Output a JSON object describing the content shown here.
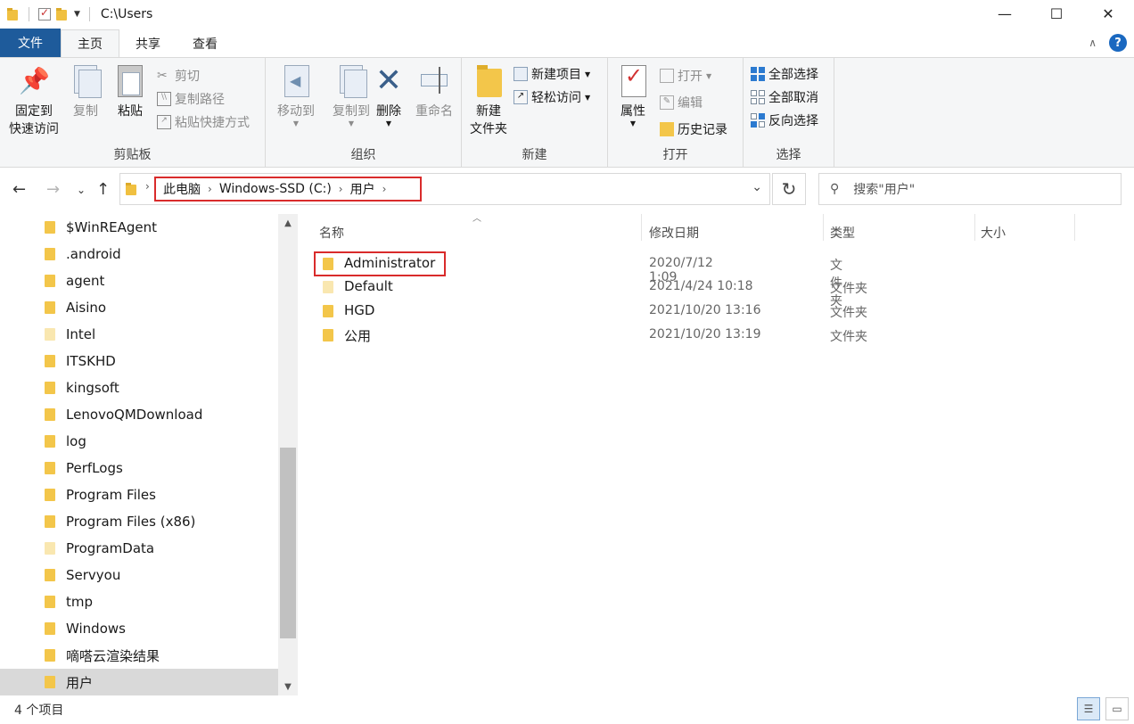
{
  "window": {
    "title": "C:\\Users",
    "controls": {
      "minimize": "—",
      "maximize": "☐",
      "close": "✕"
    }
  },
  "ribbon_tabs": [
    "文件",
    "主页",
    "共享",
    "查看"
  ],
  "ribbon": {
    "clipboard": {
      "label": "剪贴板",
      "pin_line1": "固定到",
      "pin_line2": "快速访问",
      "copy": "复制",
      "paste": "粘贴",
      "cut": "剪切",
      "copy_path": "复制路径",
      "paste_shortcut": "粘贴快捷方式"
    },
    "organize": {
      "label": "组织",
      "move_to": "移动到",
      "copy_to": "复制到",
      "delete": "删除",
      "rename": "重命名"
    },
    "new": {
      "label": "新建",
      "new_folder_line1": "新建",
      "new_folder_line2": "文件夹",
      "new_item": "新建项目",
      "easy_access": "轻松访问"
    },
    "open": {
      "label": "打开",
      "properties": "属性",
      "open": "打开",
      "edit": "编辑",
      "history": "历史记录"
    },
    "select": {
      "label": "选择",
      "select_all": "全部选择",
      "select_none": "全部取消",
      "invert": "反向选择"
    }
  },
  "address": {
    "crumbs": [
      "此电脑",
      "Windows-SSD (C:)",
      "用户"
    ]
  },
  "search": {
    "placeholder": "搜索\"用户\""
  },
  "nav_tree": [
    {
      "name": "$WinREAgent",
      "light": false
    },
    {
      "name": ".android",
      "light": false
    },
    {
      "name": "agent",
      "light": false
    },
    {
      "name": "Aisino",
      "light": false
    },
    {
      "name": "Intel",
      "light": true
    },
    {
      "name": "ITSKHD",
      "light": false
    },
    {
      "name": "kingsoft",
      "light": false
    },
    {
      "name": "LenovoQMDownload",
      "light": false
    },
    {
      "name": "log",
      "light": false
    },
    {
      "name": "PerfLogs",
      "light": false
    },
    {
      "name": "Program Files",
      "light": false
    },
    {
      "name": "Program Files (x86)",
      "light": false
    },
    {
      "name": "ProgramData",
      "light": true
    },
    {
      "name": "Servyou",
      "light": false
    },
    {
      "name": "tmp",
      "light": false
    },
    {
      "name": "Windows",
      "light": false
    },
    {
      "name": "嘀嗒云渲染结果",
      "light": false
    },
    {
      "name": "用户",
      "light": false,
      "selected": true
    }
  ],
  "columns": {
    "name": "名称",
    "date": "修改日期",
    "type": "类型",
    "size": "大小"
  },
  "files": [
    {
      "name": "Administrator",
      "date": "2020/7/12 1:09",
      "type": "文件夹"
    },
    {
      "name": "Default",
      "date": "2021/4/24 10:18",
      "type": "文件夹"
    },
    {
      "name": "HGD",
      "date": "2021/10/20 13:16",
      "type": "文件夹"
    },
    {
      "name": "公用",
      "date": "2021/10/20 13:19",
      "type": "文件夹"
    }
  ],
  "status": {
    "item_count": "4 个项目"
  },
  "colors": {
    "file_tab": "#1e5b9b",
    "highlight_box": "#d92b2b",
    "selected_row": "#d9d9d9"
  }
}
